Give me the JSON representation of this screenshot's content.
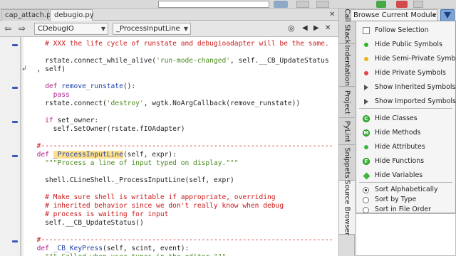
{
  "toolbar": {},
  "file_tabs": [
    {
      "label": "cap_attach.py",
      "active": false
    },
    {
      "label": "debugio.py",
      "active": true
    }
  ],
  "navbar": {
    "back_glyph": "⇦",
    "forward_glyph": "⇨",
    "class_combo": "CDebugIO",
    "method_combo": "_ProcessInputLine",
    "target_glyph": "◎",
    "left_glyph": "◀",
    "right_glyph": "▶",
    "close_glyph": "✕"
  },
  "tabs_close_glyph": "✕",
  "code_lines": [
    {
      "segments": [
        {
          "t": "    ",
          "c": ""
        },
        {
          "t": "# XXX the life cycle of runstate and debugioadapter will be the same.",
          "c": "cm"
        }
      ]
    },
    {
      "segments": []
    },
    {
      "segments": [
        {
          "t": "    rstate.connect_while_alive(",
          "c": ""
        },
        {
          "t": "'run-mode-changed'",
          "c": "str"
        },
        {
          "t": ", self.__CB_UpdateStatus",
          "c": ""
        }
      ]
    },
    {
      "segments": [
        {
          "t": "  , self)",
          "c": ""
        }
      ]
    },
    {
      "segments": []
    },
    {
      "segments": [
        {
          "t": "    ",
          "c": ""
        },
        {
          "t": "def",
          "c": "kw"
        },
        {
          "t": " ",
          "c": ""
        },
        {
          "t": "remove_runstate",
          "c": "fn"
        },
        {
          "t": "():",
          "c": ""
        }
      ]
    },
    {
      "segments": [
        {
          "t": "      ",
          "c": ""
        },
        {
          "t": "pass",
          "c": "kw"
        }
      ]
    },
    {
      "segments": [
        {
          "t": "    rstate.connect(",
          "c": ""
        },
        {
          "t": "'destroy'",
          "c": "str"
        },
        {
          "t": ", wgtk.NoArgCallback(remove_runstate))",
          "c": ""
        }
      ]
    },
    {
      "segments": []
    },
    {
      "segments": [
        {
          "t": "    ",
          "c": ""
        },
        {
          "t": "if",
          "c": "kw"
        },
        {
          "t": " set_owner:",
          "c": ""
        }
      ]
    },
    {
      "segments": [
        {
          "t": "      self.SetOwner(rstate.fIOAdapter)",
          "c": ""
        }
      ]
    },
    {
      "segments": []
    },
    {
      "segments": [
        {
          "t": "  #-----------------------------------------------------------------------",
          "c": "sep"
        }
      ]
    },
    {
      "segments": [
        {
          "t": "  ",
          "c": ""
        },
        {
          "t": "def",
          "c": "kw"
        },
        {
          "t": " ",
          "c": ""
        },
        {
          "t": "_ProcessInputLine",
          "c": "fnhl"
        },
        {
          "t": "(self, expr):",
          "c": ""
        }
      ]
    },
    {
      "segments": [
        {
          "t": "    ",
          "c": ""
        },
        {
          "t": "\"\"\"Process a line of input typed on display.\"\"\"",
          "c": "str"
        }
      ]
    },
    {
      "segments": []
    },
    {
      "segments": [
        {
          "t": "    shell.CLineShell._ProcessInputLine(self, expr)",
          "c": ""
        }
      ]
    },
    {
      "segments": []
    },
    {
      "segments": [
        {
          "t": "    ",
          "c": ""
        },
        {
          "t": "# Make sure shell is writable if appropriate, overriding",
          "c": "cm"
        }
      ]
    },
    {
      "segments": [
        {
          "t": "    ",
          "c": ""
        },
        {
          "t": "# inherited behavior since we don't really know when debug",
          "c": "cm"
        }
      ]
    },
    {
      "segments": [
        {
          "t": "    ",
          "c": ""
        },
        {
          "t": "# process is waiting for input",
          "c": "cm"
        }
      ]
    },
    {
      "segments": [
        {
          "t": "    self.__CB_UpdateStatus()",
          "c": ""
        }
      ]
    },
    {
      "segments": []
    },
    {
      "segments": [
        {
          "t": "  #-----------------------------------------------------------------------",
          "c": "sep"
        }
      ]
    },
    {
      "segments": [
        {
          "t": "  ",
          "c": ""
        },
        {
          "t": "def",
          "c": "kw"
        },
        {
          "t": " ",
          "c": ""
        },
        {
          "t": "_CB_KeyPress",
          "c": "fn"
        },
        {
          "t": "(self, scint, event):",
          "c": ""
        }
      ]
    },
    {
      "segments": [
        {
          "t": "    ",
          "c": ""
        },
        {
          "t": "\"\"\" Called when user types in the editor \"\"\"",
          "c": "str"
        }
      ]
    }
  ],
  "side_tabs": [
    "Call Stack",
    "Indentation",
    "Project",
    "PyLint",
    "Snippets",
    "Source Browser"
  ],
  "browser": {
    "mode_combo": "Browse Current Module"
  },
  "menu": {
    "items": [
      {
        "label": "Follow Selection",
        "icon": "checkbox",
        "kind": "check"
      },
      {
        "label": "Hide Public Symbols",
        "icon": "green-dot-icon",
        "kind": "dot",
        "color": "#2fb52f"
      },
      {
        "label": "Hide Semi-Private Symbols",
        "icon": "yellow-dot-icon",
        "kind": "dot",
        "color": "#e8b81e"
      },
      {
        "label": "Hide Private Symbols",
        "icon": "red-dot-icon",
        "kind": "dot",
        "color": "#e04545"
      },
      {
        "label": "Show Inherited Symbols",
        "icon": "triangle-icon",
        "kind": "tri"
      },
      {
        "label": "Show Imported Symbols",
        "icon": "triangle-icon",
        "kind": "tri"
      },
      {
        "label": "Hide Classes",
        "icon": "class-icon",
        "kind": "big",
        "letter": "C"
      },
      {
        "label": "Hide Methods",
        "icon": "method-icon",
        "kind": "big",
        "letter": "M"
      },
      {
        "label": "Hide Attributes",
        "icon": "attribute-icon",
        "kind": "dot",
        "color": "#3db53d"
      },
      {
        "label": "Hide Functions",
        "icon": "function-icon",
        "kind": "big",
        "letter": "F"
      },
      {
        "label": "Hide Variables",
        "icon": "variable-icon",
        "kind": "diamond",
        "color": "#3db53d"
      },
      {
        "label": "Sort Alphabetically",
        "icon": "radio-icon",
        "kind": "radio",
        "selected": true
      },
      {
        "label": "Sort by Type",
        "icon": "radio-icon",
        "kind": "radio",
        "selected": false
      },
      {
        "label": "Sort in File Order",
        "icon": "radio-icon",
        "kind": "radio",
        "selected": false
      }
    ]
  }
}
